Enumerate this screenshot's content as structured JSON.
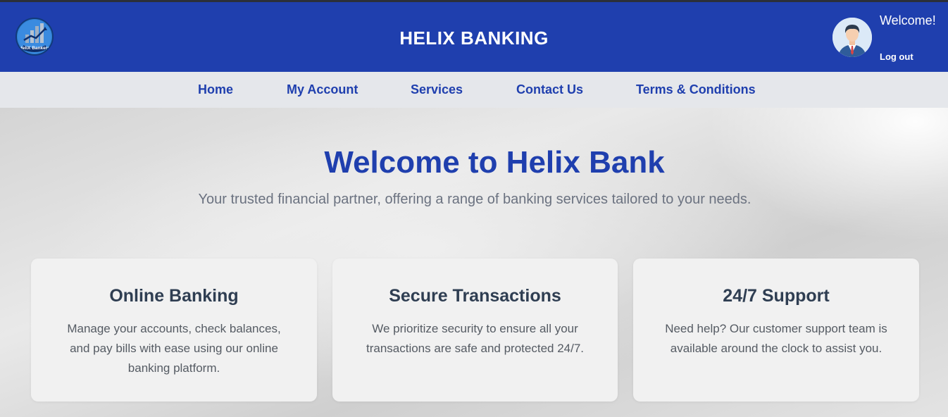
{
  "header": {
    "logo_text": "HeliX Bankers",
    "title": "HELIX BANKING",
    "welcome": "Welcome!",
    "logout": "Log out"
  },
  "nav": {
    "items": [
      "Home",
      "My Account",
      "Services",
      "Contact Us",
      "Terms & Conditions"
    ]
  },
  "hero": {
    "title": "Welcome to Helix Bank",
    "subtitle": "Your trusted financial partner, offering a range of banking services tailored to your needs."
  },
  "features": [
    {
      "title": "Online Banking",
      "text": "Manage your accounts, check balances, and pay bills with ease using our online banking platform."
    },
    {
      "title": "Secure Transactions",
      "text": "We prioritize security to ensure all your transactions are safe and protected 24/7."
    },
    {
      "title": "24/7 Support",
      "text": "Need help? Our customer support team is available around the clock to assist you."
    }
  ],
  "colors": {
    "brand": "#1f3fae",
    "nav_bg": "#e5e7eb",
    "card_bg": "#f1f1f1"
  }
}
